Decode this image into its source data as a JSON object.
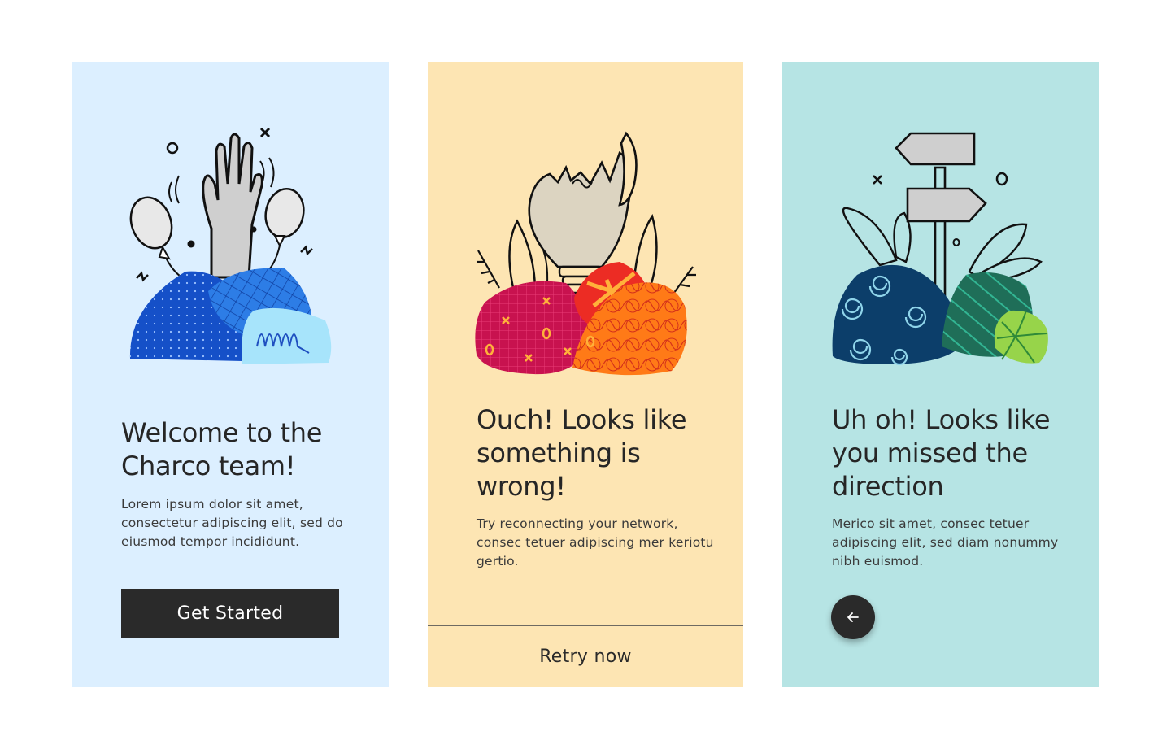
{
  "welcome_card": {
    "title": "Welcome to the Charco team!",
    "body": "Lorem ipsum dolor sit amet, consectetur adipiscing elit, sed do eiusmod tempor incididunt.",
    "button_label": "Get Started",
    "illustration": "hand-and-balloons-illustration",
    "background_color": "#dcefff"
  },
  "error_card": {
    "title": "Ouch! Looks like something is wrong!",
    "body": "Try reconnecting your network, consec tetuer adipiscing mer keriotu gertio.",
    "button_label": "Retry now",
    "illustration": "broken-lightbulb-illustration",
    "background_color": "#fde5b3"
  },
  "lost_card": {
    "title": "Uh oh! Looks like you missed the direction",
    "body": "Merico sit amet, consec tetuer adipiscing elit, sed diam nonummy nibh euismod.",
    "button_icon": "arrow-left-icon",
    "illustration": "signpost-illustration",
    "background_color": "#b6e4e4"
  },
  "colors": {
    "dark": "#2a2a2a",
    "white": "#ffffff"
  }
}
